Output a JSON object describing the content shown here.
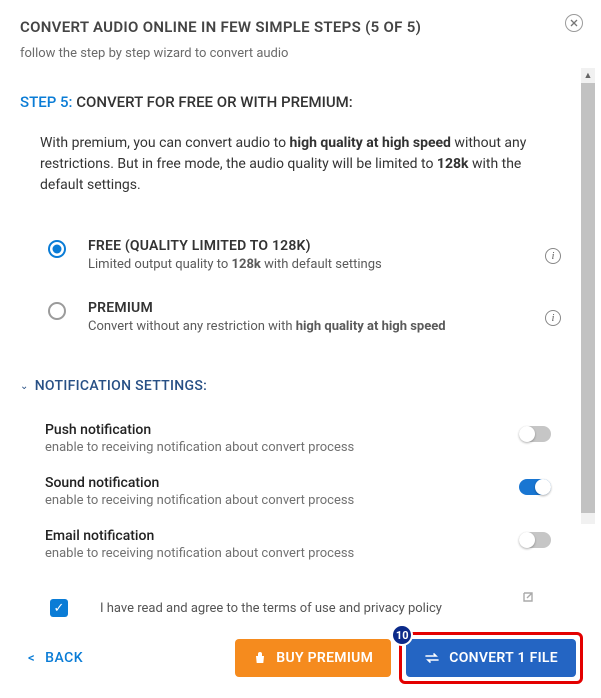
{
  "header": {
    "title": "CONVERT AUDIO ONLINE IN FEW SIMPLE STEPS (5 OF 5)",
    "subtitle": "follow the step by step wizard to convert audio"
  },
  "step": {
    "label": "STEP 5: ",
    "heading": "CONVERT FOR FREE OR WITH PREMIUM:",
    "body_pre": "With premium, you can convert audio to ",
    "body_bold1": "high quality at high speed",
    "body_mid": " without any restrictions. But in free mode, the audio quality will be limited to ",
    "body_bold2": "128k",
    "body_post": " with the default settings."
  },
  "options": {
    "free": {
      "title": "FREE (QUALITY LIMITED TO 128K)",
      "desc_pre": "Limited output quality to ",
      "desc_bold": "128k",
      "desc_post": " with default settings"
    },
    "premium": {
      "title": "PREMIUM",
      "desc_pre": "Convert without any restriction with ",
      "desc_bold": "high quality at high speed"
    }
  },
  "notifications": {
    "section_title": "NOTIFICATION SETTINGS:",
    "push": {
      "title": "Push notification",
      "desc": "enable to receiving notification about convert process",
      "on": false
    },
    "sound": {
      "title": "Sound notification",
      "desc": "enable to receiving notification about convert process",
      "on": true
    },
    "email": {
      "title": "Email notification",
      "desc": "enable to receiving notification about convert process",
      "on": false
    }
  },
  "terms": {
    "checked": true,
    "text": "I have read and agree to the terms of use and privacy policy"
  },
  "footer": {
    "back": "BACK",
    "buy": "BUY PREMIUM",
    "convert": "CONVERT 1 FILE",
    "badge": "10"
  }
}
